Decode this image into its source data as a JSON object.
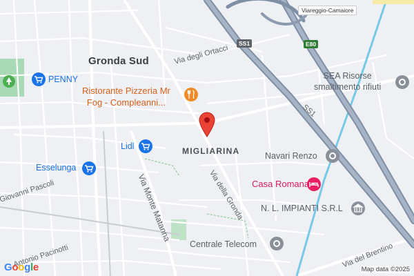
{
  "areas": {
    "gronda_sud": "Gronda Sud",
    "migliarina": "MIGLIARINA"
  },
  "streets": {
    "degli_ortacci": "Via degli Ortacci",
    "della_gronda": "Via della Gronda",
    "monte_matanna": "Via Monte Matanna",
    "giovanni_pascoli": "Giovanni Pascoli",
    "antonio_pacinotti": "Antonio Pacinotti",
    "del_brentino": "Via del Brentino"
  },
  "road_shields": {
    "ss1_top": "SS1",
    "e80": "E80",
    "ss1_diag": "SS1",
    "viareggio": "Viareggio-Camaiore"
  },
  "pois": {
    "penny": "PENNY",
    "ristorante_line1": "Ristorante Pizzeria Mr",
    "ristorante_line2": "Fog - Compleanni...",
    "lidl": "Lidl",
    "esselunga": "Esselunga",
    "sea_line1": "SEA Risorse",
    "sea_line2": "smaltimento rifiuti",
    "navari": "Navari Renzo",
    "casa_romana": "Casa Romana",
    "nl_impianti": "N. L. IMPIANTI S.R.L",
    "centrale_telecom": "Centrale Telecom"
  },
  "icons": {
    "shopping": "shopping-cart-icon",
    "restaurant": "fork-knife-icon",
    "hotel": "bed-icon",
    "generic": "location-dot-icon",
    "bank": "building-icon",
    "park": "tree-icon",
    "pin": "map-pin-icon"
  },
  "colors": {
    "poi_blue": "#1a73e8",
    "restaurant_orange": "#f08a24",
    "hotel_pink": "#e91e63",
    "highway": "#8c9bb0",
    "park_green": "#a8dab5",
    "canal": "#78c8e8",
    "pin_red": "#ea4335"
  },
  "attribution": {
    "logo": "Google",
    "credit": "Map data ©2025"
  }
}
